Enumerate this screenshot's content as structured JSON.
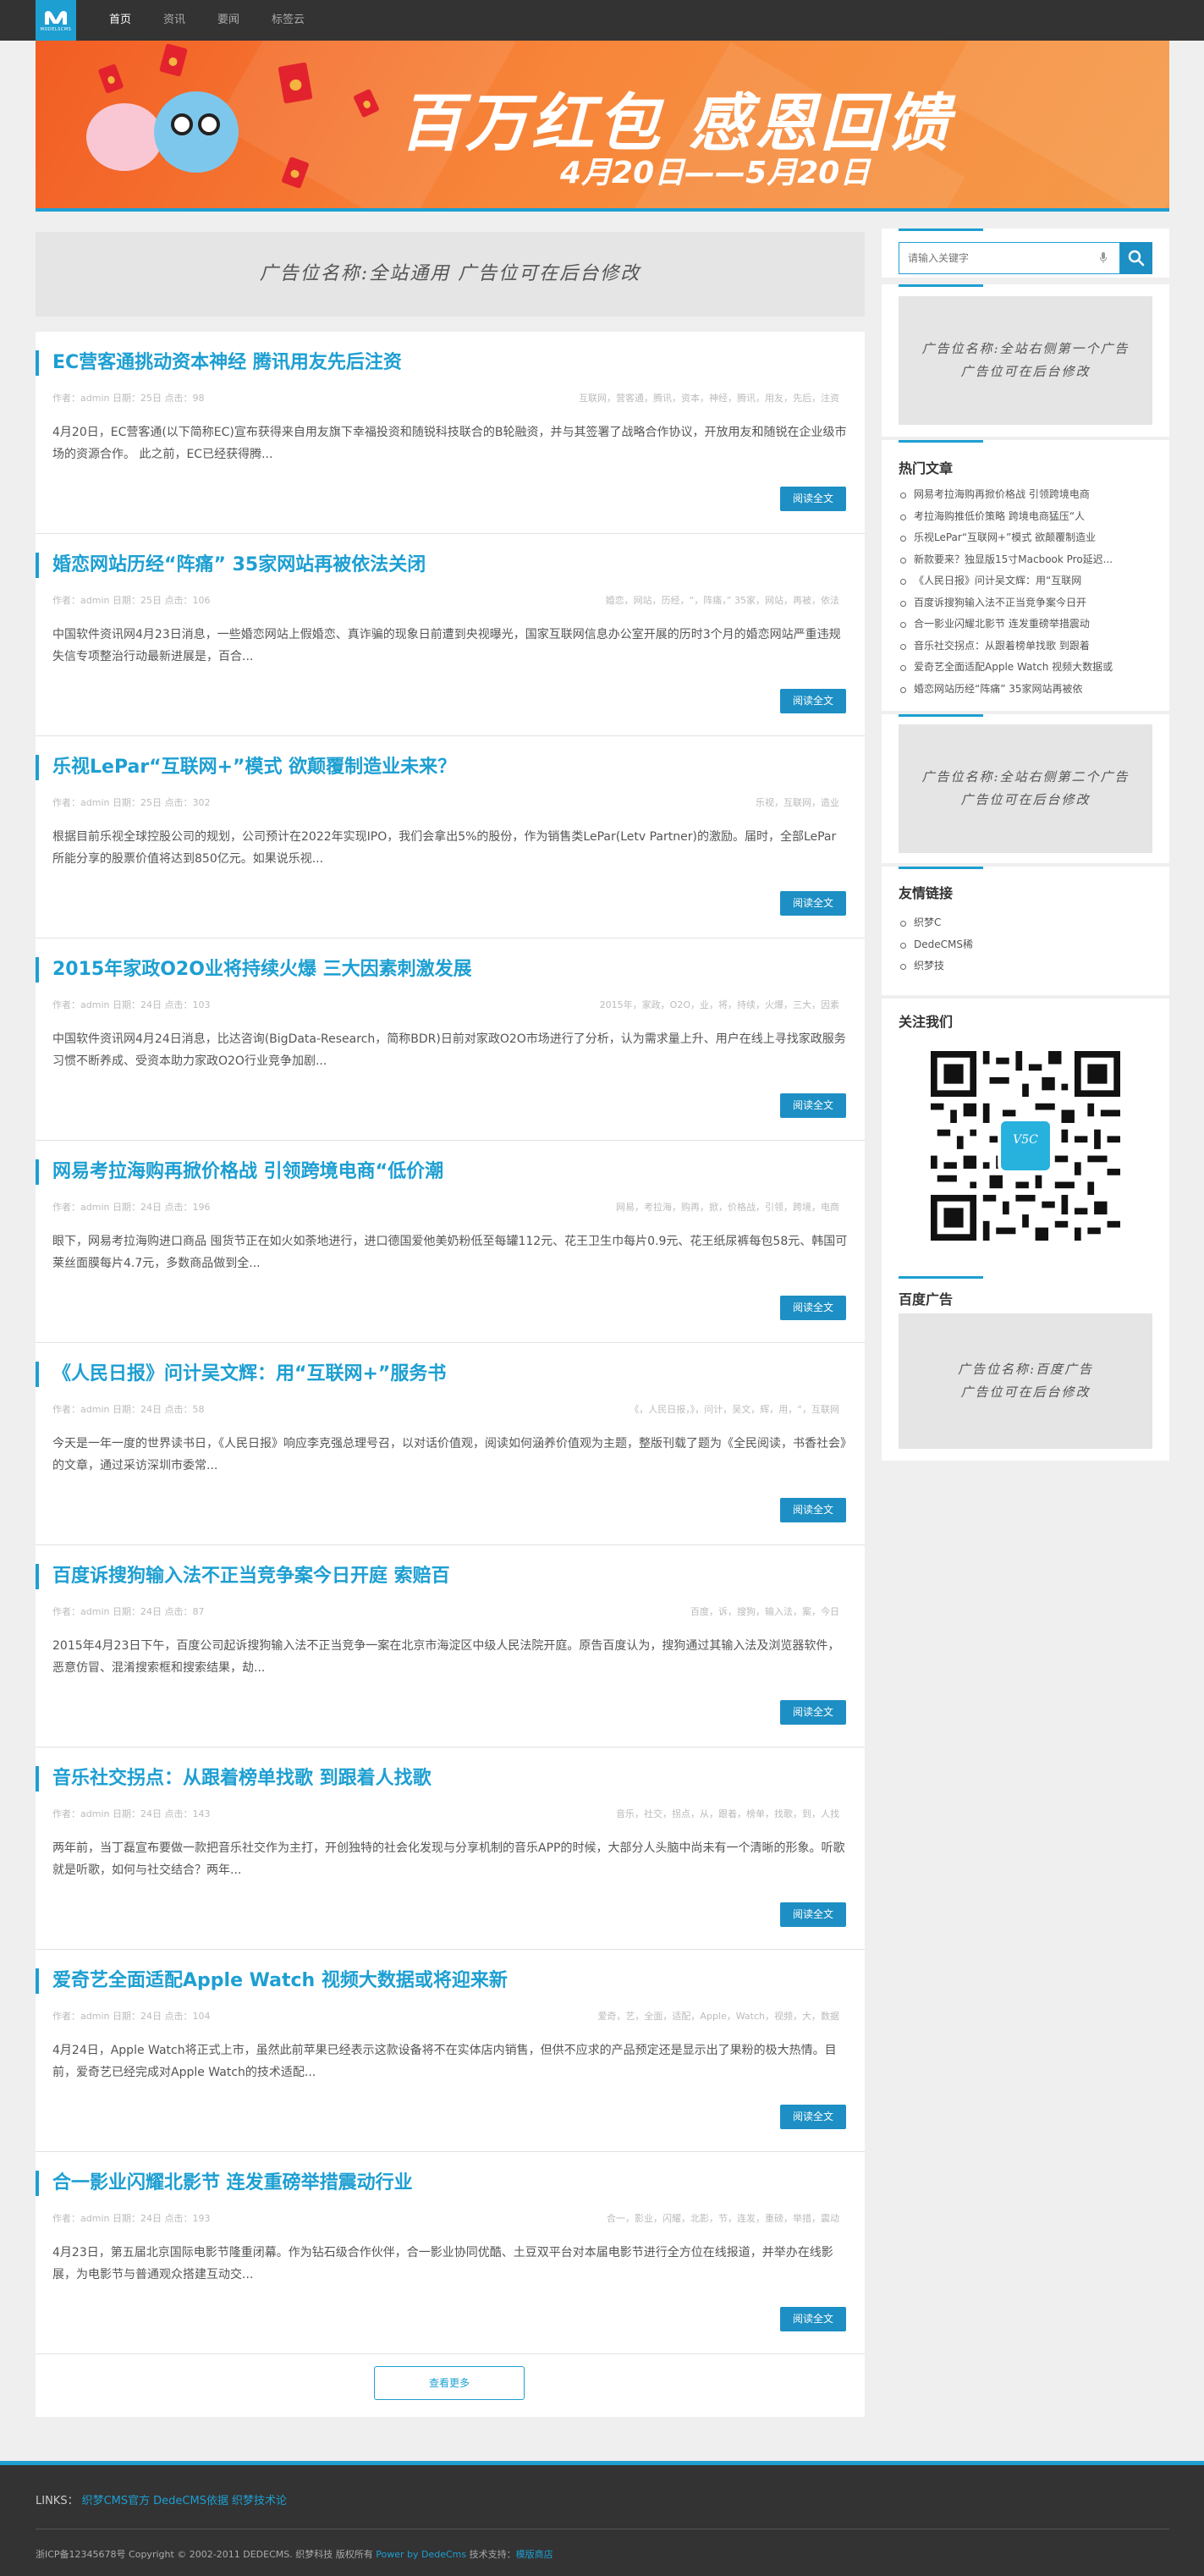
{
  "nav": {
    "logo_caption": "MODELSCMS",
    "items": [
      {
        "label": "首页",
        "active": true
      },
      {
        "label": "资讯",
        "active": false
      },
      {
        "label": "要闻",
        "active": false
      },
      {
        "label": "标签云",
        "active": false
      }
    ]
  },
  "banner": {
    "title": "百万红包 感恩回馈",
    "date": "4月20日——5月20日"
  },
  "ads": {
    "top": "广告位名称:全站通用 广告位可在后台修改",
    "side_first_line1": "广告位名称:全站右侧第一个广告",
    "side_first_line2": "广告位可在后台修改",
    "side_second_line1": "广告位名称:全站右侧第二个广告",
    "side_second_line2": "广告位可在后台修改",
    "baidu_line1": "广告位名称:百度广告",
    "baidu_line2": "广告位可在后台修改"
  },
  "articles": [
    {
      "title": "EC营客通挑动资本神经 腾讯用友先后注资",
      "meta": "作者：admin 日期：25日 点击：98",
      "tags": "互联网，营客通，腾讯，资本，神经，腾讯，用友，先后，注资",
      "desc": "4月20日，EC营客通(以下简称EC)宣布获得来自用友旗下幸福投资和随锐科技联合的B轮融资，并与其签署了战略合作协议，开放用友和随锐在企业级市场的资源合作。 此之前，EC已经获得腾...",
      "read": "阅读全文"
    },
    {
      "title": "婚恋网站历经“阵痛” 35家网站再被依法关闭",
      "meta": "作者：admin 日期：25日 点击：106",
      "tags": "婚恋，网站，历经，“，阵痛，” 35家，网站，再被，依法",
      "desc": "中国软件资讯网4月23日消息，一些婚恋网站上假婚恋、真诈骗的现象日前遭到央视曝光，国家互联网信息办公室开展的历时3个月的婚恋网站严重违规失信专项整治行动最新进展是，百合...",
      "read": "阅读全文"
    },
    {
      "title": "乐视LePar“互联网+”模式 欲颠覆制造业未来？",
      "meta": "作者：admin 日期：25日 点击：302",
      "tags": "乐视，互联网，造业",
      "desc": "根据目前乐视全球控股公司的规划，公司预计在2022年实现IPO，我们会拿出5%的股份，作为销售类LePar(Letv Partner)的激励。届时，全部LePar所能分享的股票价值将达到850亿元。如果说乐视...",
      "read": "阅读全文"
    },
    {
      "title": "2015年家政O2O业将持续火爆 三大因素刺激发展",
      "meta": "作者：admin 日期：24日 点击：103",
      "tags": "2015年，家政，O2O，业，将，持续，火爆，三大，因素",
      "desc": "中国软件资讯网4月24日消息，比达咨询(BigData-Research，简称BDR)日前对家政O2O市场进行了分析，认为需求量上升、用户在线上寻找家政服务习惯不断养成、受资本助力家政O2O行业竞争加剧...",
      "read": "阅读全文"
    },
    {
      "title": "网易考拉海购再掀价格战 引领跨境电商“低价潮",
      "meta": "作者：admin 日期：24日 点击：196",
      "tags": "网易，考拉海，购再，掀，价格战，引领，跨境，电商",
      "desc": "眼下，网易考拉海购进口商品 囤货节正在如火如荼地进行，进口德国爱他美奶粉低至每罐112元、花王卫生巾每片0.9元、花王纸尿裤每包58元、韩国可莱丝面膜每片4.7元，多数商品做到全...",
      "read": "阅读全文"
    },
    {
      "title": "《人民日报》问计吴文辉：用“互联网+”服务书",
      "meta": "作者：admin 日期：24日 点击：58",
      "tags": "《，人民日报，》，问计，吴文，辉，用，“，互联网",
      "desc": "今天是一年一度的世界读书日，《人民日报》响应李克强总理号召，以对话价值观，阅读如何涵养价值观为主题，整版刊载了题为《全民阅读，书香社会》的文章，通过采访深圳市委常...",
      "read": "阅读全文"
    },
    {
      "title": "百度诉搜狗输入法不正当竞争案今日开庭 索赔百",
      "meta": "作者：admin 日期：24日 点击：87",
      "tags": "百度，诉，搜狗，输入法，案，今日",
      "desc": "2015年4月23日下午，百度公司起诉搜狗输入法不正当竞争一案在北京市海淀区中级人民法院开庭。原告百度认为，搜狗通过其输入法及浏览器软件，恶意仿冒、混淆搜索框和搜索结果，劫...",
      "read": "阅读全文"
    },
    {
      "title": "音乐社交拐点：从跟着榜单找歌 到跟着人找歌",
      "meta": "作者：admin 日期：24日 点击：143",
      "tags": "音乐，社交，拐点，从，跟着，榜单，找歌，到，人找",
      "desc": "两年前，当丁磊宣布要做一款把音乐社交作为主打，开创独特的社会化发现与分享机制的音乐APP的时候，大部分人头脑中尚未有一个清晰的形象。听歌就是听歌，如何与社交结合？两年...",
      "read": "阅读全文"
    },
    {
      "title": "爱奇艺全面适配Apple Watch 视频大数据或将迎来新",
      "meta": "作者：admin 日期：24日 点击：104",
      "tags": "爱奇，艺，全面，适配，Apple，Watch，视频，大，数据",
      "desc": "4月24日，Apple Watch将正式上市，虽然此前苹果已经表示这款设备将不在实体店内销售，但供不应求的产品预定还是显示出了果粉的极大热情。目前，爱奇艺已经完成对Apple Watch的技术适配...",
      "read": "阅读全文"
    },
    {
      "title": "合一影业闪耀北影节 连发重磅举措震动行业",
      "meta": "作者：admin 日期：24日 点击：193",
      "tags": "合一，影业，闪耀，北影，节，连发，重磅，举措，震动",
      "desc": "4月23日，第五届北京国际电影节隆重闭幕。作为钻石级合作伙伴，合一影业协同优酷、土豆双平台对本届电影节进行全方位在线报道，并举办在线影展，为电影节与普通观众搭建互动交...",
      "read": "阅读全文"
    }
  ],
  "more_label": "查看更多",
  "search": {
    "placeholder": "请输入关键字"
  },
  "hot": {
    "title": "热门文章",
    "items": [
      "网易考拉海购再掀价格战 引领跨境电商",
      "考拉海购推低价策略 跨境电商猛压“人",
      "乐视LePar“互联网+”模式 欲颠覆制造业",
      "新款要来？独显版15寸Macbook Pro延迟...",
      "《人民日报》问计吴文辉：用“互联网",
      "百度诉搜狗输入法不正当竞争案今日开",
      "合一影业闪耀北影节 连发重磅举措震动",
      "音乐社交拐点：从跟着榜单找歌 到跟着",
      "爱奇艺全面适配Apple Watch 视频大数据或",
      "婚恋网站历经“阵痛” 35家网站再被依"
    ]
  },
  "friends": {
    "title": "友情链接",
    "items": [
      "织梦C",
      "DedeCMS稀",
      "织梦技"
    ]
  },
  "follow": {
    "title": "关注我们",
    "qr_label": "V5C"
  },
  "baidu": {
    "title": "百度广告"
  },
  "footer": {
    "links_label": "LINKS：",
    "links": [
      "织梦CMS官方",
      "DedeCMS依据",
      "织梦技术论"
    ],
    "copy_pre": "浙ICP备12345678号 Copyright © 2002-2011 DEDECMS. 织梦科技 版权所有",
    "power": "Power by DedeCms",
    "support_label": "技术支持：",
    "support": "模版商店"
  },
  "colors": {
    "accent": "#1d9fd2",
    "button": "#1d8fc4",
    "dark": "#333333"
  }
}
